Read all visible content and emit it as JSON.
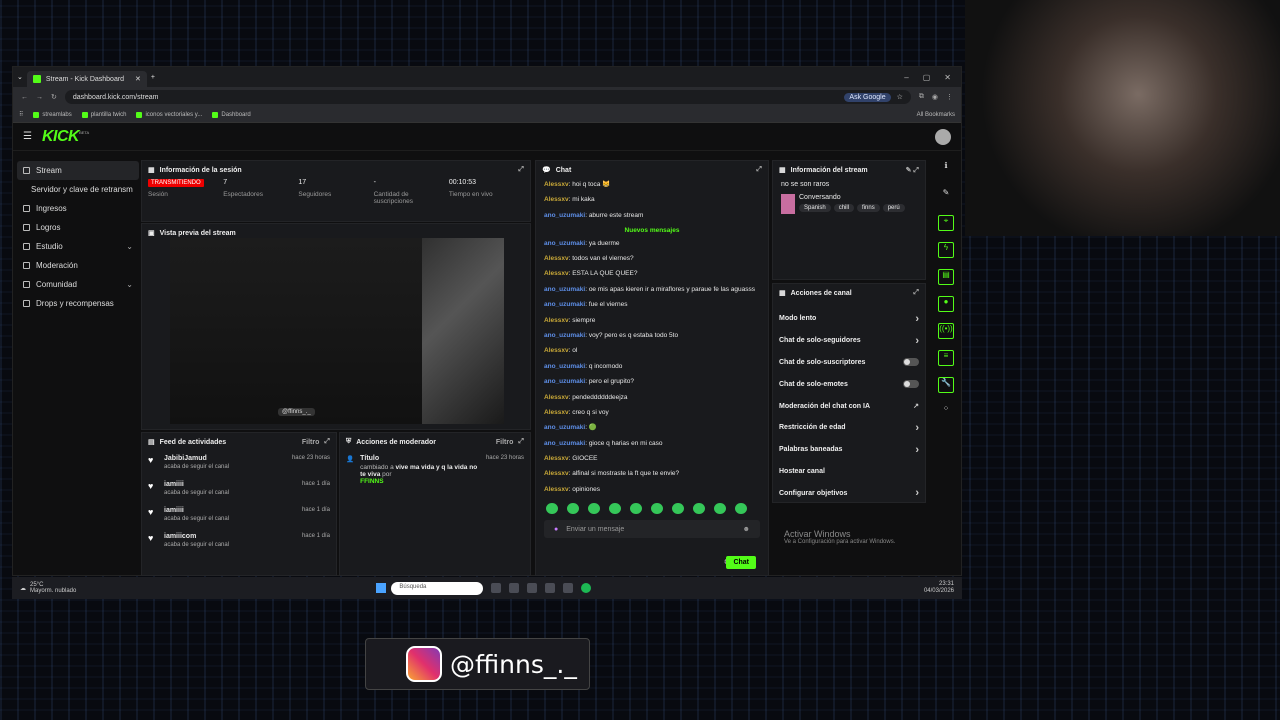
{
  "browser": {
    "tab_title": "Stream - Kick Dashboard",
    "url": "dashboard.kick.com/stream",
    "ask_google": "Ask Google",
    "bookmarks": [
      "streamlabs",
      "plantilla twich",
      "iconos vectoriales y...",
      "Dashboard"
    ],
    "all_bookmarks": "All Bookmarks"
  },
  "app": {
    "logo": "KICK",
    "logo_badge": "BETA"
  },
  "sidebar": {
    "items": [
      {
        "label": "Stream"
      },
      {
        "label": "Servidor y clave de retransm"
      },
      {
        "label": "Ingresos"
      },
      {
        "label": "Logros"
      },
      {
        "label": "Estudio"
      },
      {
        "label": "Moderación"
      },
      {
        "label": "Comunidad"
      },
      {
        "label": "Drops y recompensas"
      }
    ]
  },
  "session": {
    "title": "Información de la sesión",
    "status": "TRANSMITIENDO",
    "status_label": "Sesión",
    "viewers": "7",
    "viewers_label": "Espectadores",
    "followers": "17",
    "followers_label": "Seguidores",
    "subs": "-",
    "subs_label": "Cantidad de suscripciones",
    "time": "00:10:53",
    "time_label": "Tiempo en vivo"
  },
  "preview": {
    "title": "Vista previa del stream",
    "tag": "@ffinns_._"
  },
  "feed": {
    "title": "Feed de actividades",
    "filter": "Filtro",
    "items": [
      {
        "name": "JabibiJamud",
        "sub": "acaba de seguir el canal",
        "time": "hace 23 horas"
      },
      {
        "name": "iamiiii",
        "sub": "acaba de seguir el canal",
        "time": "hace 1 día"
      },
      {
        "name": "iamiiii",
        "sub": "acaba de seguir el canal",
        "time": "hace 1 día"
      },
      {
        "name": "iamiiicom",
        "sub": "acaba de seguir el canal",
        "time": "hace 1 día"
      }
    ]
  },
  "modactions": {
    "title": "Acciones de moderador",
    "filter": "Filtro",
    "item_title": "Título",
    "item_time": "hace 23 horas",
    "item_pre": "cambiado a",
    "item_bold": "vive ma vida y q la vida no te viva",
    "item_por": "por",
    "item_user": "FFINNS"
  },
  "chat": {
    "title": "Chat",
    "new_label": "Nuevos mensajes",
    "placeholder": "Enviar un mensaje",
    "send": "Chat",
    "messages_before": [
      {
        "user": "Alessxv",
        "text": "hoi q toca 😸",
        "c": "u1"
      },
      {
        "user": "Alessxv",
        "text": "mi kaka",
        "c": "u1"
      },
      {
        "user": "ano_uzumaki",
        "text": "aburre este stream",
        "c": "u2"
      }
    ],
    "messages": [
      {
        "user": "ano_uzumaki",
        "text": "ya duerme",
        "c": "u2"
      },
      {
        "user": "Alessxv",
        "text": "todos van el viernes?",
        "c": "u1"
      },
      {
        "user": "Alessxv",
        "text": "ESTA LA QUE QUEE?",
        "c": "u1"
      },
      {
        "user": "ano_uzumaki",
        "text": "oe mis apas kieren ir a miraflores y paraue fe las aguasss",
        "c": "u2"
      },
      {
        "user": "ano_uzumaki",
        "text": "fue el viernes",
        "c": "u2"
      },
      {
        "user": "Alessxv",
        "text": "siempre",
        "c": "u1"
      },
      {
        "user": "ano_uzumaki",
        "text": "voy? pero es q estaba todo 5to",
        "c": "u2"
      },
      {
        "user": "Alessxv",
        "text": "ol",
        "c": "u1"
      },
      {
        "user": "ano_uzumaki",
        "text": "q incomodo",
        "c": "u2"
      },
      {
        "user": "ano_uzumaki",
        "text": "pero el grupito?",
        "c": "u2"
      },
      {
        "user": "Alessxv",
        "text": "pendeddddddeejza",
        "c": "u1"
      },
      {
        "user": "Alessxv",
        "text": "creo q si voy",
        "c": "u1"
      },
      {
        "user": "ano_uzumaki",
        "text": "🟢",
        "c": "u2"
      },
      {
        "user": "ano_uzumaki",
        "text": "gioce q harias en mi caso",
        "c": "u2"
      },
      {
        "user": "Alessxv",
        "text": "GIOCEE",
        "c": "u1"
      },
      {
        "user": "Alessxv",
        "text": "alfinal si mostraste la ft que te envie?",
        "c": "u1"
      },
      {
        "user": "Alessxv",
        "text": "opiniones",
        "c": "u1"
      }
    ]
  },
  "streaminfo": {
    "title": "Información del stream",
    "stream_title": "no se son raros",
    "category": "Conversando",
    "tags": [
      "Spanish",
      "chill",
      "finns",
      "perú"
    ]
  },
  "channel": {
    "title": "Acciones de canal",
    "rows": [
      {
        "label": "Modo lento",
        "kind": "chev"
      },
      {
        "label": "Chat de solo-seguidores",
        "kind": "chev"
      },
      {
        "label": "Chat de solo-suscriptores",
        "kind": "toggle"
      },
      {
        "label": "Chat de solo-emotes",
        "kind": "toggle"
      },
      {
        "label": "Moderación del chat con IA",
        "kind": "ext"
      },
      {
        "label": "Restricción de edad",
        "kind": "chev"
      },
      {
        "label": "Palabras baneadas",
        "kind": "chev"
      },
      {
        "label": "Hostear canal",
        "kind": "none"
      },
      {
        "label": "Configurar objetivos",
        "kind": "chev"
      }
    ]
  },
  "activate": {
    "title": "Activar Windows",
    "sub": "Ve a Configuración para activar Windows."
  },
  "taskbar": {
    "temp": "25°C",
    "weather": "Mayorm. nublado",
    "search": "Búsqueda",
    "time": "23:31",
    "date": "04/03/2026"
  },
  "overlay": {
    "handle": "@ffinns_._"
  }
}
